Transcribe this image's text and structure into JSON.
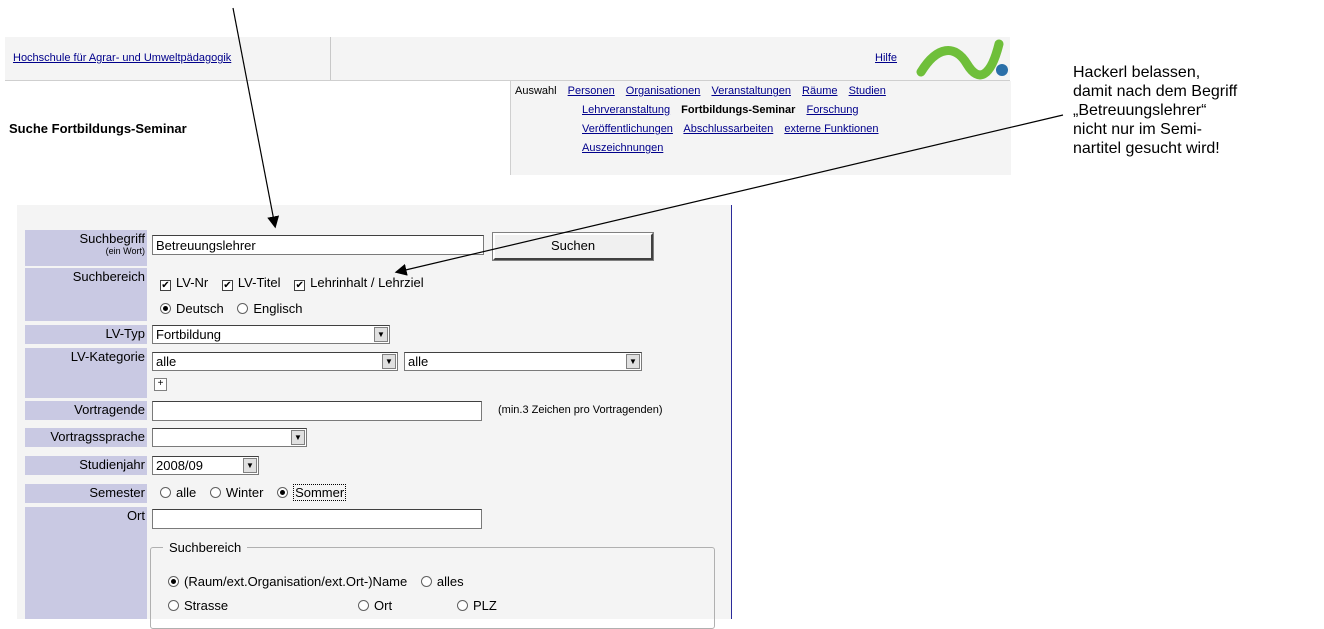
{
  "header": {
    "institution_link": "Hochschule für Agrar- und Umweltpädagogik",
    "help_link": "Hilfe",
    "page_title": "Suche Fortbildungs-Seminar",
    "nav_label": "Auswahl",
    "nav_links": [
      "Personen",
      "Organisationen",
      "Veranstaltungen",
      "Räume",
      "Studien",
      "Lehrveranstaltung",
      "Fortbildungs-Seminar",
      "Forschung",
      "Veröffentlichungen",
      "Abschlussarbeiten",
      "externe Funktionen",
      "Auszeichnungen"
    ]
  },
  "form": {
    "suchbegriff_label": "Suchbegriff",
    "suchbegriff_sub": "(ein Wort)",
    "suchbegriff_value": "Betreuungslehrer",
    "search_button": "Suchen",
    "suchbereich_label": "Suchbereich",
    "cb_lvnr": "LV-Nr",
    "cb_lvtitel": "LV-Titel",
    "cb_lehrinhalt": "Lehrinhalt / Lehrziel",
    "lang_de": "Deutsch",
    "lang_en": "Englisch",
    "lvtyp_label": "LV-Typ",
    "lvtyp_value": "Fortbildung",
    "lvkat_label": "LV-Kategorie",
    "lvkat_value1": "alle",
    "lvkat_value2": "alle",
    "vortragende_label": "Vortragende",
    "vortragende_hint": "(min.3 Zeichen pro Vortragenden)",
    "vortragssprache_label": "Vortragssprache",
    "vortragssprache_value": "",
    "studienjahr_label": "Studienjahr",
    "studienjahr_value": "2008/09",
    "semester_label": "Semester",
    "sem_alle": "alle",
    "sem_winter": "Winter",
    "sem_sommer": "Sommer",
    "ort_label": "Ort",
    "ort_value": "",
    "fs_legend": "Suchbereich",
    "fs_name": "(Raum/ext.Organisation/ext.Ort-)Name",
    "fs_alles": "alles",
    "fs_strasse": "Strasse",
    "fs_ort": "Ort",
    "fs_plz": "PLZ"
  },
  "annotation": {
    "line1": "Hackerl belassen,",
    "line2": "damit nach dem Begriff",
    "line3": "„Betreuungslehrer“",
    "line4": "nicht nur im Semi-",
    "line5": "nartitel gesucht wird!"
  },
  "colors": {
    "label_bg": "#c9c9e3",
    "link": "#00008b",
    "logo_green": "#6fbf3a",
    "logo_dot": "#2a6fa8"
  }
}
